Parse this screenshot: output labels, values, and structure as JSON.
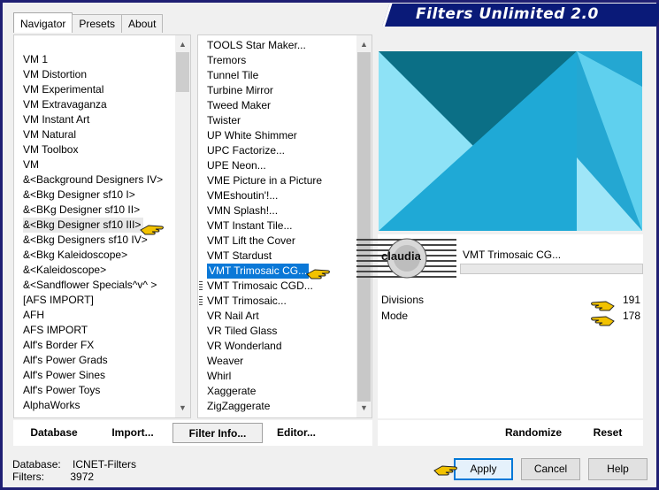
{
  "window": {
    "title": "Filters Unlimited 2.0"
  },
  "tabs": [
    {
      "label": "Navigator",
      "active": true
    },
    {
      "label": "Presets",
      "active": false
    },
    {
      "label": "About",
      "active": false
    }
  ],
  "categories": {
    "items": [
      "VM 1",
      "VM Distortion",
      "VM Experimental",
      "VM Extravaganza",
      "VM Instant Art",
      "VM Natural",
      "VM Toolbox",
      "VM",
      "&<Background Designers IV>",
      "&<Bkg Designer sf10 I>",
      "&<BKg Designer sf10 II>",
      "&<Bkg Designer sf10 III>",
      "&<Bkg Designers sf10 IV>",
      "&<Bkg Kaleidoscope>",
      "&<Kaleidoscope>",
      "&<Sandflower Specials^v^ >",
      "[AFS IMPORT]",
      "AFH",
      "AFS IMPORT",
      "Alf's Border FX",
      "Alf's Power Grads",
      "Alf's Power Sines",
      "Alf's Power Toys",
      "AlphaWorks"
    ],
    "highlighted_index": 11
  },
  "filters": {
    "items": [
      "TOOLS Star Maker...",
      "Tremors",
      "Tunnel Tile",
      "Turbine Mirror",
      "Tweed Maker",
      "Twister",
      "UP White Shimmer",
      "UPC Factorize...",
      "UPE Neon...",
      "VME Picture in a Picture",
      "VMEshoutin'!...",
      "VMN Splash!...",
      "VMT Instant Tile...",
      "VMT Lift the Cover",
      "VMT Stardust",
      "VMT Trimosaic CG...",
      "VMT Trimosaic CGD...",
      "VMT Trimosaic...",
      "VR Nail Art",
      "VR Tiled Glass",
      "VR Wonderland",
      "Weaver",
      "Whirl",
      "Xaggerate",
      "ZigZaggerate"
    ],
    "selected_index": 15
  },
  "buttons": {
    "database": "Database",
    "import": "Import...",
    "filter_info": "Filter Info...",
    "editor": "Editor...",
    "randomize": "Randomize",
    "reset": "Reset",
    "apply": "Apply",
    "cancel": "Cancel",
    "help": "Help"
  },
  "selected_filter": {
    "name": "VMT Trimosaic CG..."
  },
  "logo_text": "claudia",
  "params": [
    {
      "label": "Divisions",
      "value": "191"
    },
    {
      "label": "Mode",
      "value": "178"
    }
  ],
  "status": {
    "database_label": "Database:",
    "database_value": "ICNET-Filters",
    "filters_label": "Filters:",
    "filters_value": "3972"
  },
  "colors": {
    "title_bg": "#0a1a78",
    "selection": "#0a78d7",
    "preview_dark": "#0b6f86",
    "preview_mid": "#1fa9d6",
    "preview_light": "#8ee2f6",
    "pointer": "#f2c200"
  }
}
